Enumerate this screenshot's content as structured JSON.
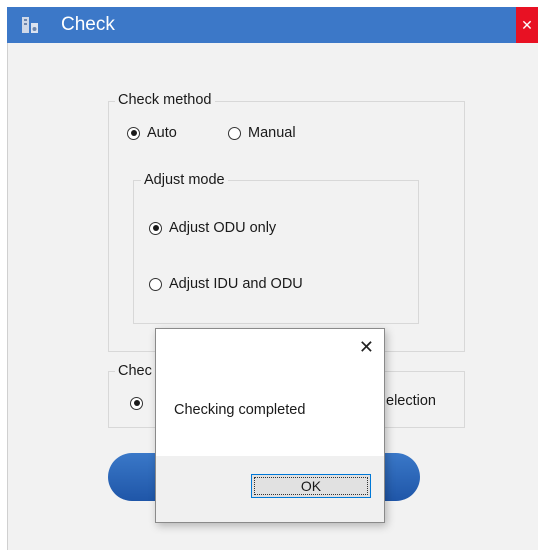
{
  "window": {
    "title": "Check",
    "close_glyph": "✕"
  },
  "check_method": {
    "label": "Check method",
    "options": [
      {
        "label": "Auto",
        "checked": true
      },
      {
        "label": "Manual",
        "checked": false
      }
    ]
  },
  "adjust_mode": {
    "label": "Adjust mode",
    "options": [
      {
        "label": "Adjust ODU only",
        "checked": true
      },
      {
        "label": "Adjust IDU and ODU",
        "checked": false
      }
    ]
  },
  "second_group": {
    "label_partial": "Chec",
    "option_partial": "election"
  },
  "dialog": {
    "close_glyph": "✕",
    "message": "Checking completed",
    "ok_label": "OK"
  },
  "colors": {
    "titlebar": "#3c78c8",
    "close": "#e81123",
    "button_blue": "#1f56a8"
  },
  "icons": {
    "app": "app-icon",
    "close": "close-icon"
  }
}
